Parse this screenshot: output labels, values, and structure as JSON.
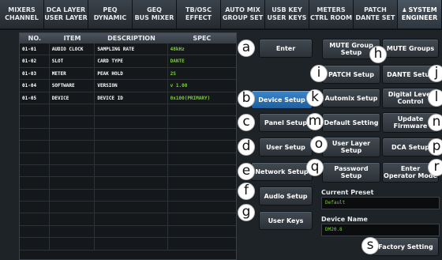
{
  "tabs": [
    {
      "line1": "MIXERS",
      "line2": "CHANNEL"
    },
    {
      "line1": "DCA LAYER",
      "line2": "USER LAYER"
    },
    {
      "line1": "PEQ",
      "line2": "DYNAMIC"
    },
    {
      "line1": "GEQ",
      "line2": "BUS MIXER"
    },
    {
      "line1": "TB/OSC",
      "line2": "EFFECT"
    },
    {
      "line1": "AUTO MIX",
      "line2": "GROUP SET"
    },
    {
      "line1": "USB KEY",
      "line2": "USER KEYS"
    },
    {
      "line1": "METERS",
      "line2": "CTRL ROOM"
    },
    {
      "line1": "PATCH",
      "line2": "DANTE SET"
    },
    {
      "line1": "SYSTEM",
      "line2": "ENGINEER",
      "icon": "user-icon"
    }
  ],
  "table": {
    "headers": [
      "NO.",
      "ITEM",
      "DESCRIPTION",
      "SPEC"
    ],
    "rows": [
      [
        "01-01",
        "AUDIO CLOCK",
        "SAMPLING RATE",
        "48kHz"
      ],
      [
        "01-02",
        "SLOT",
        "CARD TYPE",
        "DANTE"
      ],
      [
        "01-03",
        "METER",
        "PEAK HOLD",
        "2S"
      ],
      [
        "01-04",
        "SOFTWARE",
        "VERSION",
        "v 1.00"
      ],
      [
        "01-05",
        "DEVICE",
        "DEVICE ID",
        "0x100(PRIMARY)"
      ],
      [
        "",
        "",
        "",
        ""
      ],
      [
        "",
        "",
        "",
        ""
      ],
      [
        "",
        "",
        "",
        ""
      ],
      [
        "",
        "",
        "",
        ""
      ],
      [
        "",
        "",
        "",
        ""
      ],
      [
        "",
        "",
        "",
        ""
      ],
      [
        "",
        "",
        "",
        ""
      ],
      [
        "",
        "",
        "",
        ""
      ],
      [
        "",
        "",
        "",
        ""
      ],
      [
        "",
        "",
        "",
        ""
      ],
      [
        "",
        "",
        "",
        ""
      ],
      [
        "",
        "",
        "",
        ""
      ]
    ]
  },
  "buttons": {
    "enter": "Enter",
    "device_setup": "Device Setup",
    "panel_setup": "Panel Setup",
    "user_setup": "User Setup",
    "network_setup": "Network Setup",
    "audio_setup": "Audio Setup",
    "user_keys": "User Keys",
    "mute_group_setup_1": "MUTE Group",
    "mute_group_setup_2": "Setup",
    "mute_groups": "MUTE Groups",
    "patch_setup": "PATCH Setup",
    "dante_setup": "DANTE Setup",
    "automix_setup": "Automix Setup",
    "digital_level_control_1": "Digital Level",
    "digital_level_control_2": "Control",
    "default_setting": "Default Setting",
    "update_firmware_1": "Update",
    "update_firmware_2": "Firmware",
    "user_layer_setup_1": "User Layer",
    "user_layer_setup_2": "Setup",
    "dca_setup": "DCA Setup",
    "password_setup_1": "Password",
    "password_setup_2": "Setup",
    "enter_operator_mode_1": "Enter",
    "enter_operator_mode_2": "Operator Mode",
    "factory_setting": "Factory Setting"
  },
  "current_preset": {
    "label": "Current Preset",
    "value": "Default"
  },
  "device_name": {
    "label": "Device Name",
    "value": "DM20.8"
  },
  "badges": {
    "a": "a",
    "b": "b",
    "c": "c",
    "d": "d",
    "e": "e",
    "f": "f",
    "g": "g",
    "h": "h",
    "i": "i",
    "j": "j",
    "k": "k",
    "l": "l",
    "m": "m",
    "n": "n",
    "o": "o",
    "p": "p",
    "q": "q",
    "r": "r",
    "s": "s"
  },
  "colors": {
    "spec_text": "#7ccd3e",
    "active_button": "#2f78bd",
    "background": "#1e2328"
  }
}
